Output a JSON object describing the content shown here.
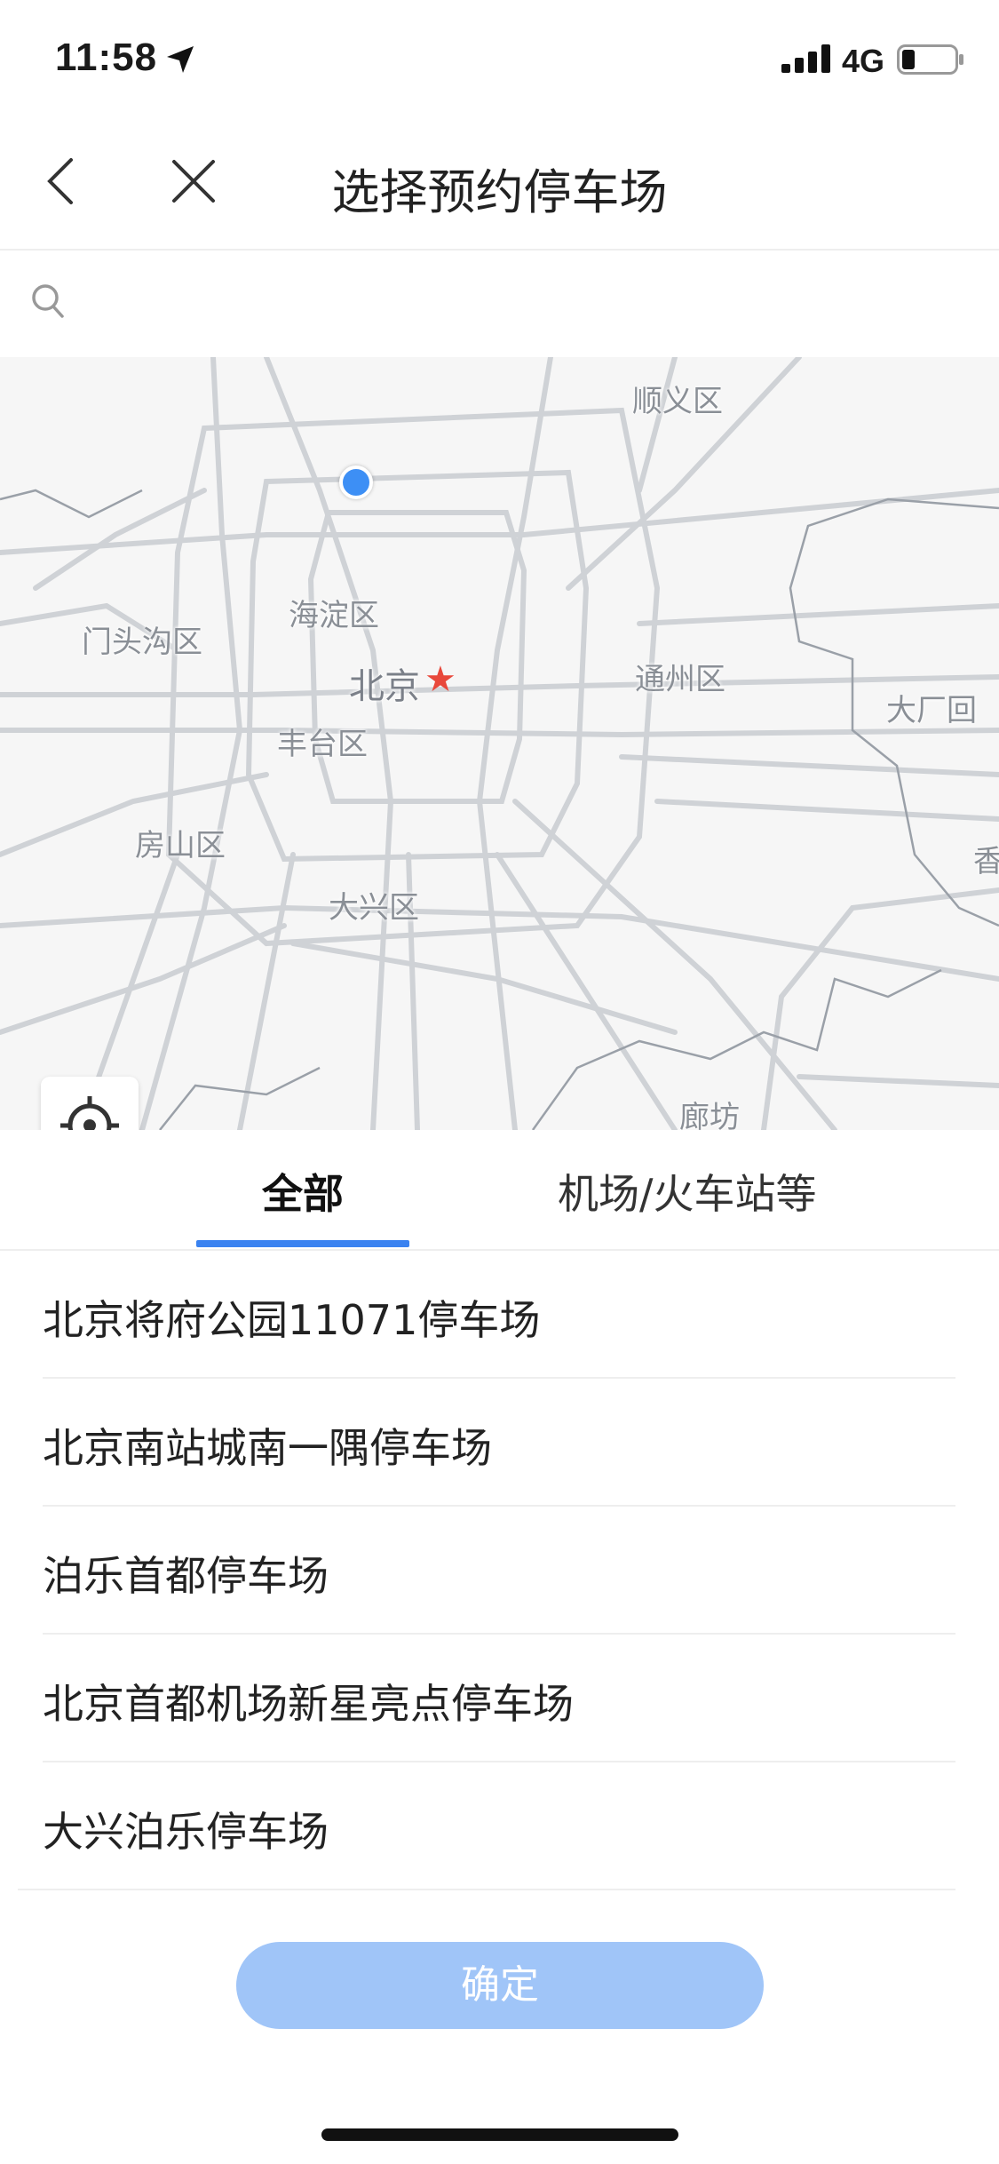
{
  "status": {
    "time": "11:58",
    "network": "4G",
    "icons": [
      "location-arrow-icon",
      "signal-icon",
      "battery-icon"
    ]
  },
  "nav": {
    "title": "选择预约停车场",
    "icons": [
      "back-icon",
      "close-icon"
    ]
  },
  "search": {
    "placeholder": "",
    "icon": "search-icon"
  },
  "map": {
    "labels": [
      {
        "text": "顺义区"
      },
      {
        "text": "海淀区"
      },
      {
        "text": "门头沟区"
      },
      {
        "text": "北京"
      },
      {
        "text": "通州区"
      },
      {
        "text": "大厂回"
      },
      {
        "text": "丰台区"
      },
      {
        "text": "房山区"
      },
      {
        "text": "大兴区"
      },
      {
        "text": "廊坊"
      },
      {
        "text": "香"
      }
    ],
    "colors": {
      "road": "#cfd2d6",
      "dot": "#3d8ff5",
      "star": "#e8483b"
    }
  },
  "tabs": [
    {
      "label": "全部",
      "selected": true
    },
    {
      "label": "机场/火车站等",
      "selected": false
    }
  ],
  "list": [
    {
      "label": "北京将府公园11071停车场"
    },
    {
      "label": "北京南站城南一隅停车场"
    },
    {
      "label": "泊乐首都停车场"
    },
    {
      "label": "北京首都机场新星亮点停车场"
    },
    {
      "label": "大兴泊乐停车场"
    }
  ],
  "confirm_label": "确定",
  "colors": {
    "accent": "#3a82f0",
    "confirm_disabled": "#a0c5f8"
  }
}
